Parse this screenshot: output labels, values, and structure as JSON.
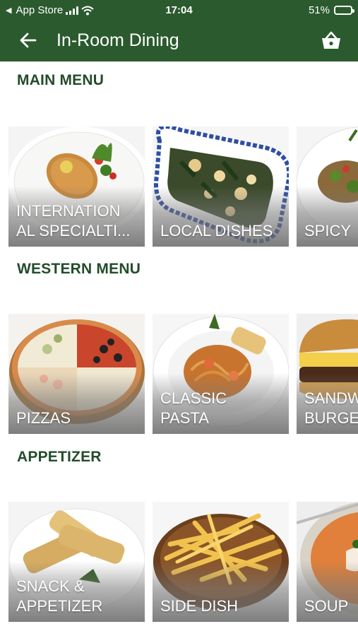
{
  "status_bar": {
    "back_app": "App Store",
    "time": "17:04",
    "battery": "51%",
    "battery_level": 0.51
  },
  "header": {
    "title": "In-Room Dining",
    "back_icon": "arrow-left-icon",
    "cart_icon": "basket-icon"
  },
  "sections": [
    {
      "title": "MAIN MENU",
      "items": [
        {
          "label": "INTERNATION\nAL SPECIALTI...",
          "image": "fried-fish-plate"
        },
        {
          "label": "LOCAL DISHES",
          "image": "stir-fry-on-blue-plate"
        },
        {
          "label": "SPICY",
          "image": "spicy-salad"
        }
      ]
    },
    {
      "title": "WESTERN MENU",
      "items": [
        {
          "label": "PIZZAS",
          "image": "pizza"
        },
        {
          "label": "CLASSIC\nPASTA",
          "image": "spaghetti-plate"
        },
        {
          "label": "SANDW\nBURGE",
          "image": "burger"
        }
      ]
    },
    {
      "title": "APPETIZER",
      "items": [
        {
          "label": "SNACK &\nAPPETIZER",
          "image": "garlic-bread"
        },
        {
          "label": "SIDE DISH",
          "image": "french-fries"
        },
        {
          "label": "SOUP",
          "image": "tomato-soup"
        }
      ]
    }
  ],
  "colors": {
    "header_bg": "#2b5a2e",
    "section_title": "#234c2b"
  }
}
